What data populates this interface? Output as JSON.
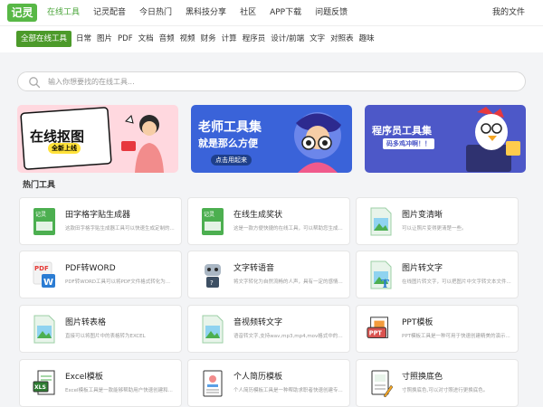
{
  "header": {
    "logo": "记灵",
    "nav": [
      "在线工具",
      "记灵配音",
      "今日热门",
      "黑科技分享",
      "社区",
      "APP下载",
      "问题反馈"
    ],
    "my_files": "我的文件"
  },
  "categories": [
    "全部在线工具",
    "日常",
    "图片",
    "PDF",
    "文档",
    "音频",
    "视频",
    "财务",
    "计算",
    "程序员",
    "设计/前端",
    "文字",
    "对照表",
    "趣味"
  ],
  "search": {
    "placeholder": "输入你想要找的在线工具..."
  },
  "banners": [
    {
      "title": "在线抠图",
      "sub": "全新上线"
    },
    {
      "title": "老师工具集",
      "title2": "就是那么方便",
      "btn": "点击用起来"
    },
    {
      "title": "程序员工具集",
      "sub": "码多鸡冲啊！！"
    }
  ],
  "section_title": "热门工具",
  "tools": [
    {
      "name": "田字格字贴生成器",
      "desc": "这款田字格字贴生成器工具可以快速生成定制的..."
    },
    {
      "name": "在线生成奖状",
      "desc": "这是一款方便快捷的在线工具，可以帮助您生成..."
    },
    {
      "name": "图片变清晰",
      "desc": "可以让照片变得更清楚一些。"
    },
    {
      "name": "PDF转WORD",
      "desc": "PDF转WORD工具可以将PDF文件格式转化为..."
    },
    {
      "name": "文字转语音",
      "desc": "将文字转化为自然流畅的人声，具有一定的感情..."
    },
    {
      "name": "图片转文字",
      "desc": "在线图片转文字，可以把图片中文字转文本文件..."
    },
    {
      "name": "图片转表格",
      "desc": "直接可以将图片中的表格转为EXCEL"
    },
    {
      "name": "音视频转文字",
      "desc": "语音转文字,支持wav,mp3,mp4,mov格式中的音频..."
    },
    {
      "name": "PPT模板",
      "desc": "PPT模板工具是一种可用于快速创建精美的演示..."
    },
    {
      "name": "Excel模板",
      "desc": "Excel模板工具是一款能够帮助用户快速创建和..."
    },
    {
      "name": "个人简历模板",
      "desc": "个人简历模板工具是一种帮助求职者快速创建专..."
    },
    {
      "name": "寸照换底色",
      "desc": "寸照换底色,可以对寸照进行更换底色。"
    }
  ],
  "colors": {
    "brand": "#58b846",
    "category_active": "#4c9a2a",
    "nav_active": "#4aa53a"
  }
}
